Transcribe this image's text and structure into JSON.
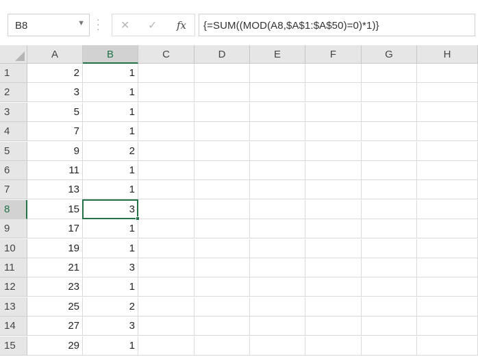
{
  "formula_bar": {
    "name_box": "B8",
    "cancel_icon": "✕",
    "enter_icon": "✓",
    "fx_label": "fx",
    "formula": "{=SUM((MOD(A8,$A$1:$A$50)=0)*1)}"
  },
  "sheet": {
    "columns": [
      "A",
      "B",
      "C",
      "D",
      "E",
      "F",
      "G",
      "H"
    ],
    "active_column": "B",
    "active_row": 8,
    "rows": [
      {
        "num": "1",
        "a": "2",
        "b": "1"
      },
      {
        "num": "2",
        "a": "3",
        "b": "1"
      },
      {
        "num": "3",
        "a": "5",
        "b": "1"
      },
      {
        "num": "4",
        "a": "7",
        "b": "1"
      },
      {
        "num": "5",
        "a": "9",
        "b": "2"
      },
      {
        "num": "6",
        "a": "11",
        "b": "1"
      },
      {
        "num": "7",
        "a": "13",
        "b": "1"
      },
      {
        "num": "8",
        "a": "15",
        "b": "3"
      },
      {
        "num": "9",
        "a": "17",
        "b": "1"
      },
      {
        "num": "10",
        "a": "19",
        "b": "1"
      },
      {
        "num": "11",
        "a": "21",
        "b": "3"
      },
      {
        "num": "12",
        "a": "23",
        "b": "1"
      },
      {
        "num": "13",
        "a": "25",
        "b": "2"
      },
      {
        "num": "14",
        "a": "27",
        "b": "3"
      },
      {
        "num": "15",
        "a": "29",
        "b": "1"
      }
    ]
  },
  "colors": {
    "accent": "#217346"
  }
}
